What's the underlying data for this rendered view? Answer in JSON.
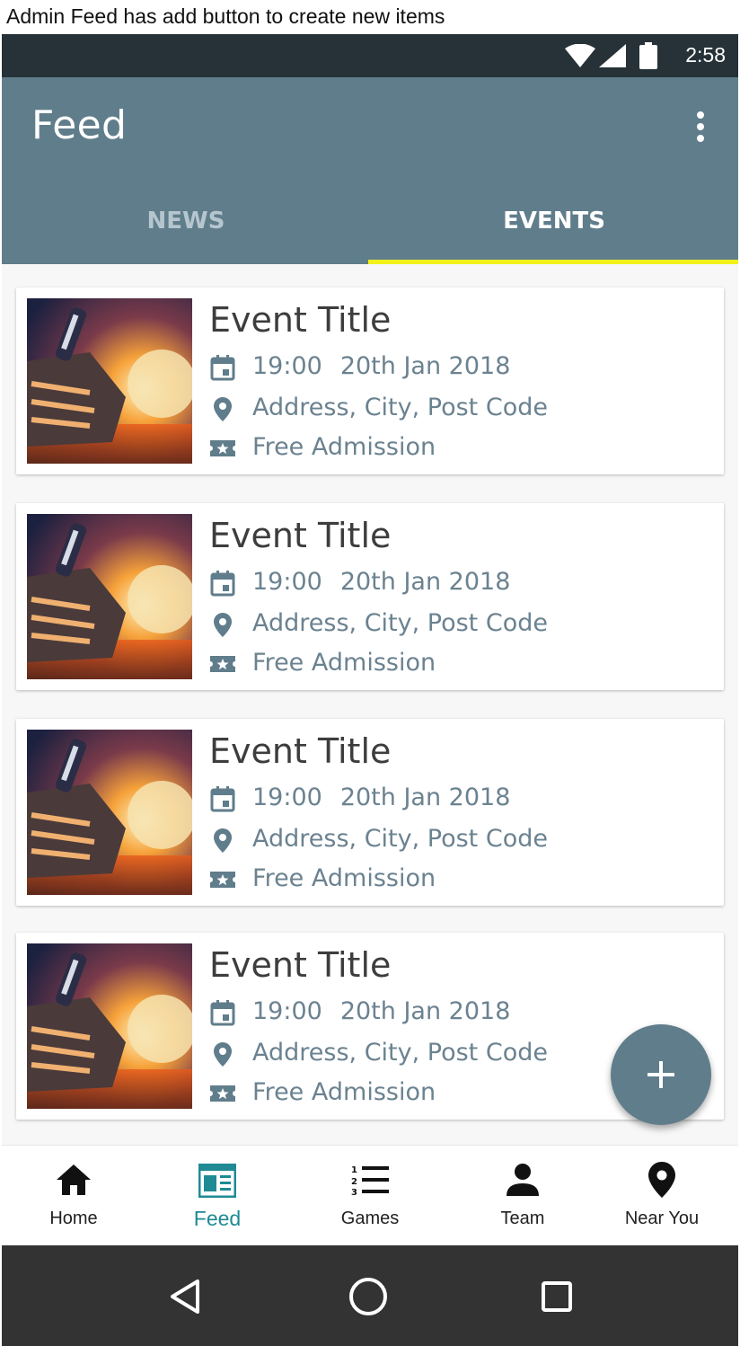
{
  "caption": "Admin Feed has add button to create new items",
  "status_bar": {
    "time": "2:58",
    "icons": [
      "wifi-icon",
      "signal-icon",
      "battery-icon"
    ]
  },
  "app_bar": {
    "title": "Feed",
    "menu_icon": "more-vert-icon"
  },
  "tabs": [
    {
      "label": "NEWS",
      "selected": false
    },
    {
      "label": "EVENTS",
      "selected": true
    }
  ],
  "events": [
    {
      "title": "Event Title",
      "time": "19:00",
      "date": "20th Jan 2018",
      "address": "Address, City, Post Code",
      "admission": "Free Admission"
    },
    {
      "title": "Event Title",
      "time": "19:00",
      "date": "20th Jan 2018",
      "address": "Address, City, Post Code",
      "admission": "Free Admission"
    },
    {
      "title": "Event Title",
      "time": "19:00",
      "date": "20th Jan 2018",
      "address": "Address, City, Post Code",
      "admission": "Free Admission"
    },
    {
      "title": "Event Title",
      "time": "19:00",
      "date": "20th Jan 2018",
      "address": "Address, City, Post Code",
      "admission": "Free Admission"
    }
  ],
  "fab": {
    "icon": "add-icon"
  },
  "bottom_nav": [
    {
      "label": "Home",
      "icon": "home-icon",
      "active": false
    },
    {
      "label": "Feed",
      "icon": "feed-icon",
      "active": true
    },
    {
      "label": "Games",
      "icon": "list-numbered-icon",
      "active": false
    },
    {
      "label": "Team",
      "icon": "person-icon",
      "active": false
    },
    {
      "label": "Near You",
      "icon": "location-pin-icon",
      "active": false
    }
  ],
  "colors": {
    "primary": "#607d8b",
    "status_bar": "#263238",
    "tab_indicator": "#f2f11a",
    "active_nav": "#1f8a94",
    "meta_text": "#6b8290"
  }
}
